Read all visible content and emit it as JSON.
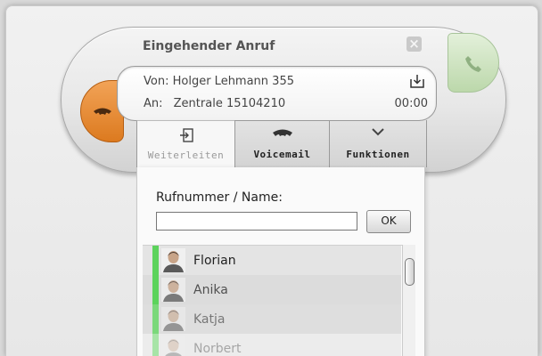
{
  "call": {
    "title": "Eingehender Anruf",
    "from_label": "Von:",
    "from_value": "Holger Lehmann 355",
    "to_label": "An:",
    "to_value": "Zentrale 15104210",
    "timer": "00:00"
  },
  "tabs": [
    {
      "label": "Weiterleiten",
      "icon": "forward-icon",
      "active": true
    },
    {
      "label": "Voicemail",
      "icon": "voicemail-icon",
      "active": false
    },
    {
      "label": "Funktionen",
      "icon": "chevron-down-icon",
      "active": false
    }
  ],
  "forward_panel": {
    "label": "Rufnummer / Name:",
    "input_value": "",
    "ok_label": "OK"
  },
  "contacts": [
    {
      "name": "Florian",
      "status_color": "#5cd35c",
      "bg": "#e4e4e4",
      "opacity": 1
    },
    {
      "name": "Anika",
      "status_color": "#5cd35c",
      "bg": "#dcdcdc",
      "opacity": 0.75
    },
    {
      "name": "Katja",
      "status_color": "#7bd87b",
      "bg": "#dedede",
      "opacity": 0.55
    },
    {
      "name": "Norbert",
      "status_color": "#a7e4a7",
      "bg": "#ececec",
      "opacity": 0.35
    }
  ],
  "colors": {
    "reject": "#e2802a",
    "accept": "#c8e0b9",
    "status_online": "#5cd35c"
  }
}
